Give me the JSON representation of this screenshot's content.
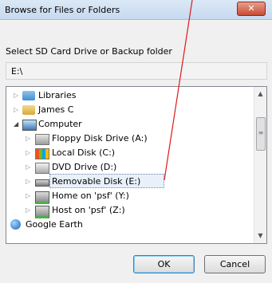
{
  "window": {
    "title": "Browse for Files or Folders",
    "close_glyph": "✕"
  },
  "instruction": "Select SD Card Drive or Backup folder",
  "path_value": "E:\\",
  "tree": {
    "items": [
      {
        "label": "Libraries",
        "icon": "libraries-icon",
        "indent": 1,
        "expander": "collapsed"
      },
      {
        "label": "James C",
        "icon": "user-folder-icon",
        "indent": 1,
        "expander": "collapsed"
      },
      {
        "label": "Computer",
        "icon": "computer-icon",
        "indent": 1,
        "expander": "expanded"
      },
      {
        "label": "Floppy Disk Drive (A:)",
        "icon": "floppy-drive-icon",
        "indent": 2,
        "expander": "collapsed"
      },
      {
        "label": "Local Disk (C:)",
        "icon": "local-disk-icon",
        "indent": 2,
        "expander": "collapsed"
      },
      {
        "label": "DVD Drive (D:)",
        "icon": "dvd-drive-icon",
        "indent": 2,
        "expander": "collapsed"
      },
      {
        "label": "Removable Disk (E:)",
        "icon": "removable-disk-icon",
        "indent": 2,
        "expander": "collapsed",
        "selected": true
      },
      {
        "label": "Home on 'psf' (Y:)",
        "icon": "network-drive-icon",
        "indent": 2,
        "expander": "collapsed"
      },
      {
        "label": "Host on 'psf' (Z:)",
        "icon": "network-drive-icon",
        "indent": 2,
        "expander": "collapsed"
      },
      {
        "label": "Google Earth",
        "icon": "google-earth-icon",
        "indent": 0,
        "expander": "none"
      }
    ]
  },
  "buttons": {
    "ok": "OK",
    "cancel": "Cancel"
  },
  "colors": {
    "annotation_line": "#e01818",
    "selection_border": "#6f8aa9"
  }
}
